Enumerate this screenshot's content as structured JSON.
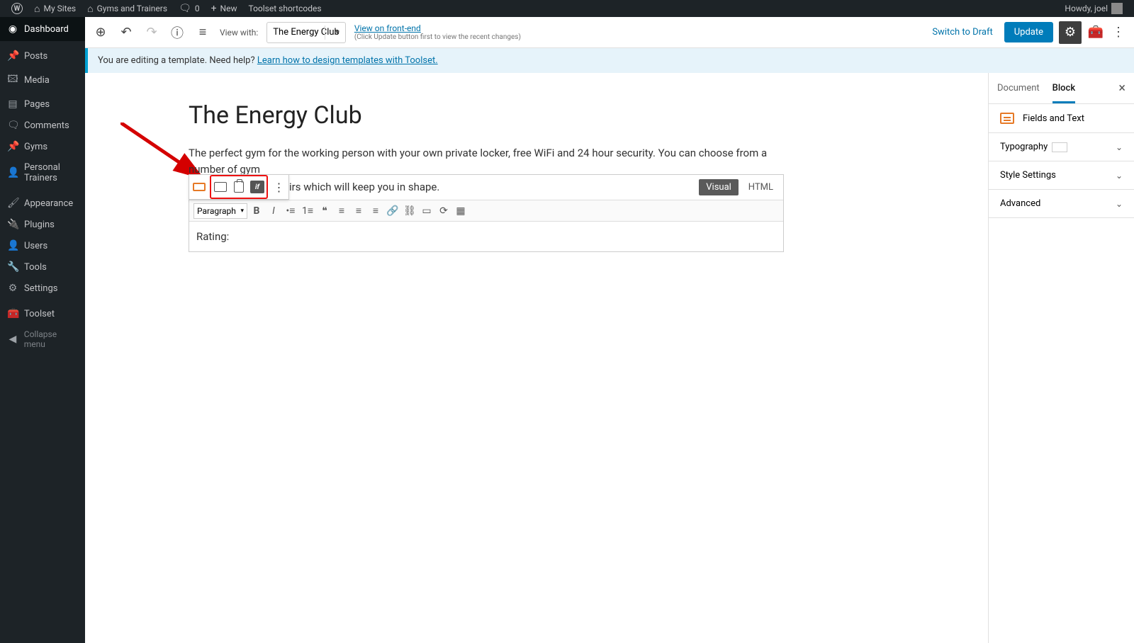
{
  "adminBar": {
    "mySites": "My Sites",
    "siteName": "Gyms and Trainers",
    "commentCount": "0",
    "newLabel": "New",
    "shortcodes": "Toolset shortcodes",
    "greeting": "Howdy, joel"
  },
  "sidebarItems": {
    "dashboard": "Dashboard",
    "posts": "Posts",
    "media": "Media",
    "pages": "Pages",
    "comments": "Comments",
    "gyms": "Gyms",
    "trainers": "Personal Trainers",
    "appearance": "Appearance",
    "plugins": "Plugins",
    "users": "Users",
    "tools": "Tools",
    "settings": "Settings",
    "toolset": "Toolset",
    "collapse": "Collapse menu"
  },
  "editorTop": {
    "viewWith": "View with:",
    "selectValue": "The Energy Club",
    "frontendLink": "View on front-end",
    "frontendSub": "(Click Update button first to view the recent changes)",
    "switchDraft": "Switch to Draft",
    "update": "Update"
  },
  "notice": {
    "prefix": "You are editing a template. Need help? ",
    "link": "Learn how to design templates with Toolset."
  },
  "post": {
    "title": "The Energy Club",
    "body": "The perfect gym for the working person with your own private locker, free WiFi and 24 hour security. You can choose from a number of gym",
    "bodyTail": "irs which will keep you in shape."
  },
  "editor": {
    "visual": "Visual",
    "html": "HTML",
    "paragraph": "Paragraph",
    "content": "Rating:"
  },
  "inspector": {
    "tabDocument": "Document",
    "tabBlock": "Block",
    "blockName": "Fields and Text",
    "panel1": "Typography",
    "panel2": "Style Settings",
    "panel3": "Advanced"
  }
}
